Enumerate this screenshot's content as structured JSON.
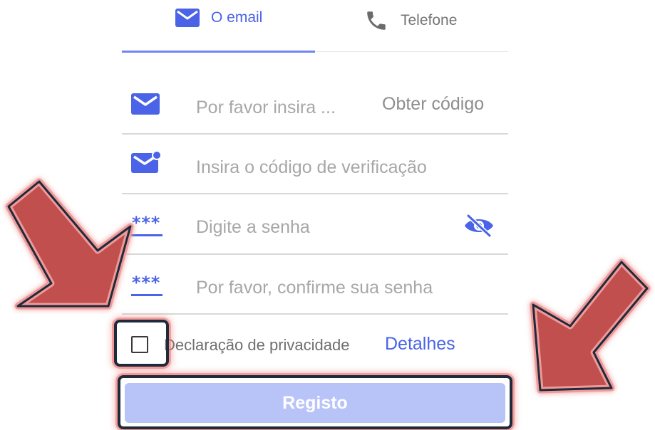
{
  "tabs": [
    {
      "label": "O email",
      "icon": "envelope-icon",
      "active": true
    },
    {
      "label": "Telefone",
      "icon": "phone-icon",
      "active": false
    }
  ],
  "form": {
    "email_placeholder": "Por favor insira ...",
    "get_code_label": "Obter código",
    "code_placeholder": "Insira o código de verificação",
    "password_placeholder": "Digite a senha",
    "confirm_placeholder": "Por favor, confirme sua senha",
    "password_icon_text": "***"
  },
  "privacy": {
    "label": "Declaração de privacidade",
    "details_label": "Detalhes",
    "checked": false
  },
  "register_label": "Registo",
  "colors": {
    "accent": "#4a63e7",
    "button_bg": "#b8c3f8",
    "arrow": "#c0504d",
    "highlight_border": "#1f2a3a"
  }
}
